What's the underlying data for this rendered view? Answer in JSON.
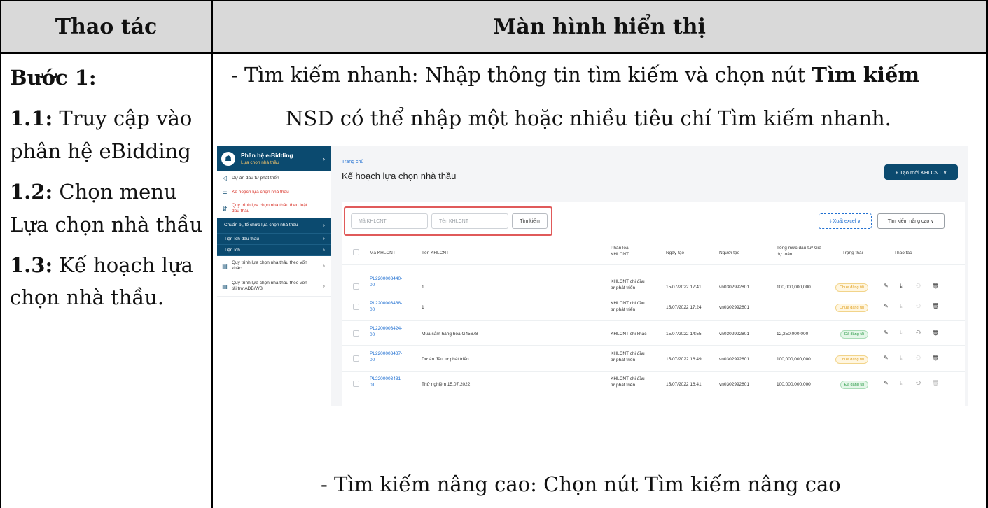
{
  "header": {
    "col1": "Thao tác",
    "col2": "Màn hình hiển thị"
  },
  "left": {
    "step": "Bước 1:",
    "s1_num": "1.1:",
    "s1_text": " Truy cập vào phân hệ eBidding",
    "s2_num": "1.2:",
    "s2_text": "  Chọn menu Lựa chọn nhà thầu",
    "s3_num": "1.3:",
    "s3_text": " Kế hoạch lựa chọn nhà thầu."
  },
  "right": {
    "line1_prefix": "- Tìm kiếm nhanh: Nhập thông tin tìm kiếm và chọn nút ",
    "line1_bold": "Tìm kiếm",
    "line2": "NSD có thể nhập một hoặc nhiều tiêu chí Tìm kiếm nhanh.",
    "bottom": "- Tìm kiếm nâng cao: Chọn nút Tìm kiếm nâng cao"
  },
  "shot": {
    "sidebar": {
      "app_title": "Phân hệ e-Bidding",
      "app_sub": "Lựa chọn nhà thầu",
      "items": [
        "Dự án đầu tư phát triển",
        "Kế hoạch lựa chọn nhà thầu",
        "Quy trình lựa chọn nhà thầu theo luật đấu thầu"
      ],
      "sub_items": [
        "Chuẩn bị, tổ chức lựa chọn nhà thầu",
        "Tiện ích đấu thầu",
        "Tiện ích"
      ],
      "items2": [
        "Quy trình lựa chọn nhà thầu theo vốn khác",
        "Quy trình lựa chọn nhà thầu theo vốn tài trợ ADB/WB"
      ]
    },
    "breadcrumb": "Trang chủ",
    "title": "Kế hoạch lựa chọn nhà thầu",
    "create_btn": "+ Tạo mới KHLCNT ∨",
    "search": {
      "code_ph": "Mã KHLCNT",
      "name_ph": "Tên KHLCNT",
      "btn": "Tìm kiếm"
    },
    "excel_btn": "⤓ Xuất excel ∨",
    "adv_btn": "Tìm kiếm nâng cao ∨",
    "columns": [
      "Mã KHLCNT",
      "Tên KHLCNT",
      "Phân loại KHLCNT",
      "Ngày tạo",
      "Người tạo",
      "Tổng mức đầu tư/ Giá dự toán",
      "Trạng thái",
      "Thao tác"
    ],
    "rows": [
      {
        "code": "PL2200003440-00",
        "name": "1",
        "cls": "KHLCNT chi đầu tư phát triển",
        "date": "15/07/2022 17:41",
        "user": "vn0302992801",
        "amount": "100,000,000,000",
        "status": "Chưa đăng tải",
        "st": "pend"
      },
      {
        "code": "PL2200003438-00",
        "name": "1",
        "cls": "KHLCNT chi đầu tư phát triển",
        "date": "15/07/2022 17:24",
        "user": "vn0302992801",
        "amount": "",
        "status": "Chưa đăng tải",
        "st": "pend"
      },
      {
        "code": "PL2200003424-00",
        "name": "Mua sắm hàng hóa G45678",
        "cls": "KHLCNT chi khác",
        "date": "15/07/2022 14:55",
        "user": "vn0302992801",
        "amount": "12,250,000,000",
        "status": "Đã đăng tải",
        "st": "done"
      },
      {
        "code": "PL2200003437-00",
        "name": "Dự án đầu tư phát triển",
        "cls": "KHLCNT chi đầu tư phát triển",
        "date": "15/07/2022 16:49",
        "user": "vn0302992801",
        "amount": "100,000,000,000",
        "status": "Chưa đăng tải",
        "st": "pend"
      },
      {
        "code": "PL2200003431-01",
        "name": "Thử nghiệm 15.07.2022",
        "cls": "KHLCNT chi đầu tư phát triển",
        "date": "15/07/2022 16:41",
        "user": "vn0302992801",
        "amount": "100,000,000,000",
        "status": "Đã đăng tải",
        "st": "done"
      }
    ],
    "action_icons": [
      "pencil-icon",
      "download-icon",
      "users-icon",
      "trash-icon"
    ]
  }
}
